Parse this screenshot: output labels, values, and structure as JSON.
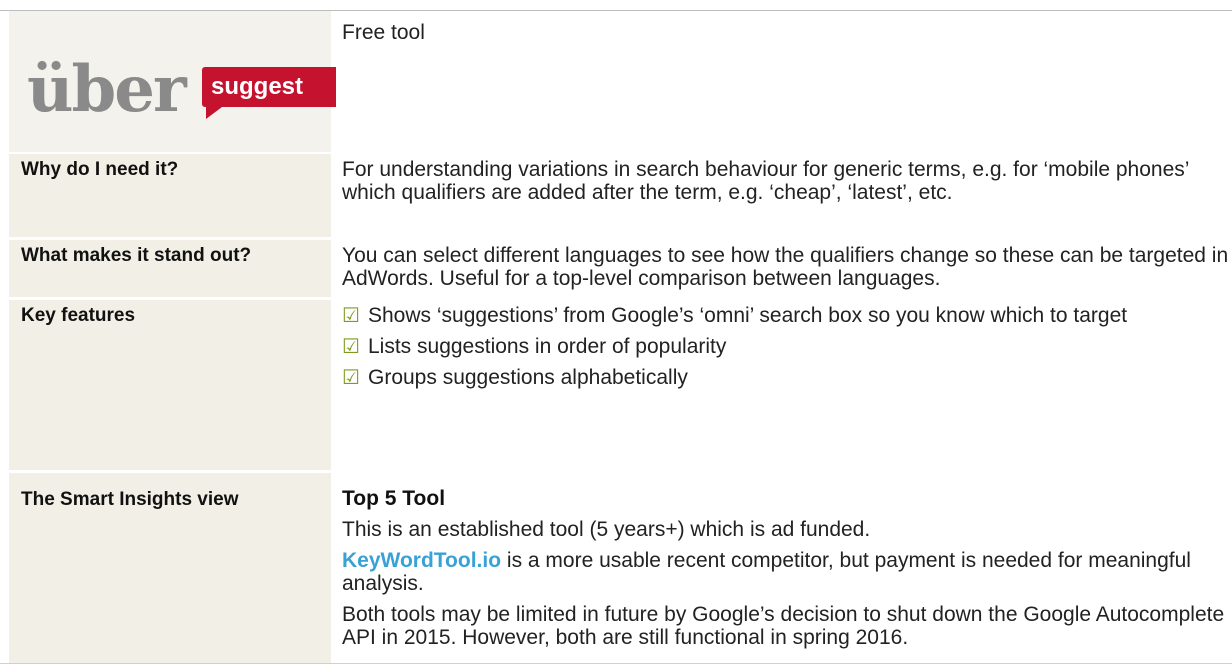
{
  "header": {
    "free_tool": "Free tool",
    "logo": {
      "part1": "über",
      "part2": "suggest",
      "badge_color": "#c4122f",
      "gray": "#8a8a8a"
    }
  },
  "rows": [
    {
      "label": "Why do I need it?",
      "text": "For understanding variations in search behaviour for generic terms, e.g. for ‘mobile phones’ which qualifiers are added after the term, e.g. ‘cheap’, ‘latest’, etc."
    },
    {
      "label": "What makes it stand out?",
      "text": "You can select different languages to see how the qualifiers change so these can be targeted in AdWords. Useful for a top-level comparison between languages."
    },
    {
      "label": "Key features",
      "features": [
        "Shows ‘suggestions’ from Google’s ‘omni’ search box so you know which to target",
        "Lists suggestions in order of popularity",
        "Groups suggestions alphabetically"
      ],
      "tick_icon": "checkbox-tick-icon",
      "tick_color": "#7c9c1f"
    },
    {
      "label": "The Smart Insights view",
      "heading": "Top 5 Tool",
      "p1": "This is an established tool (5 years+) which is ad funded.",
      "link_text": "KeyWordTool.io",
      "p2_rest": " is a more usable recent competitor, but payment is needed for meaningful analysis.",
      "p3": "Both tools may be limited in future by Google’s decision to shut down the Google Autocomplete API in 2015. However, both are still functional in spring 2016.",
      "link_color": "#38a2d6"
    }
  ],
  "colors": {
    "label_bg": "#f2efe6",
    "text": "#222222"
  }
}
